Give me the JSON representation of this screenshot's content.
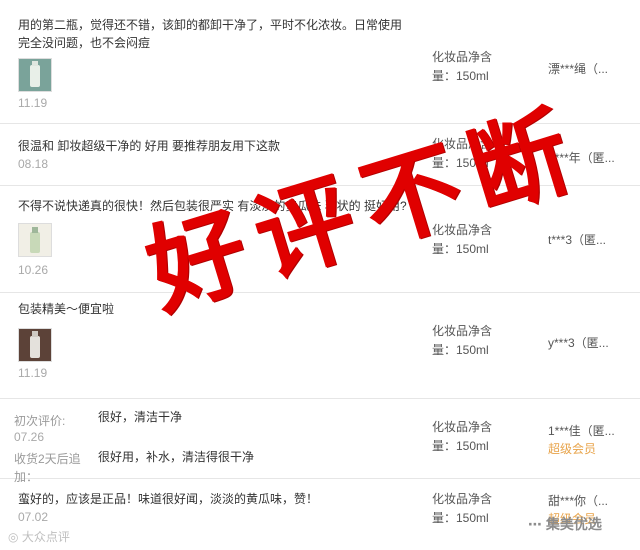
{
  "reviews": [
    {
      "comment_line1": "用的第二瓶，觉得还不错，该卸的都卸干净了，平时不化浓妆。日常使用",
      "comment_line2": "完全没问题，也不会闷痘",
      "date": "11.19",
      "sku_line1": "化妆品净含",
      "sku_line2": "量：150ml",
      "user": "漂***绳（..."
    },
    {
      "comment_line1": "很温和 卸妆超级干净的 好用 要推荐朋友用下这款",
      "date": "08.18",
      "sku_line1": "化妆品净含",
      "sku_line2": "量：150ml",
      "user": "d***年（匿..."
    },
    {
      "comment_line1": "不得不说快递真的很快！然后包装很严实 有淡淡的黄瓜味 乳状的 挺好用?",
      "date": "10.26",
      "sku_line1": "化妆品净含",
      "sku_line2": "量：150ml",
      "user": "t***3（匿..."
    },
    {
      "comment_line1": "包装精美～便宜啦",
      "date": "11.19",
      "sku_line1": "化妆品净含",
      "sku_line2": "量：150ml",
      "user": "y***3（匿..."
    },
    {
      "initial_label": "初次评价:",
      "initial_comment": "很好，清洁干净",
      "date": "07.26",
      "followup_label_line1": "收货2天后追",
      "followup_label_line2": "加：",
      "followup_comment": "很好用，补水，清洁得很干净",
      "sku_line1": "化妆品净含",
      "sku_line2": "量：150ml",
      "user": "1***佳（匿...",
      "badge": "超级会员"
    },
    {
      "comment_line1": "蛮好的，应该是正品！味道很好闻，淡淡的黄瓜味，赞！",
      "date": "07.02",
      "sku_line1": "化妆品净含",
      "sku_line2": "量：150ml",
      "user": "甜***你（...",
      "badge": "超级会员"
    }
  ],
  "overlay": {
    "stamp_text": "好评不断",
    "stamp_color": "#e00000"
  },
  "watermarks": {
    "left": "大众点评",
    "right": "集美优选"
  }
}
